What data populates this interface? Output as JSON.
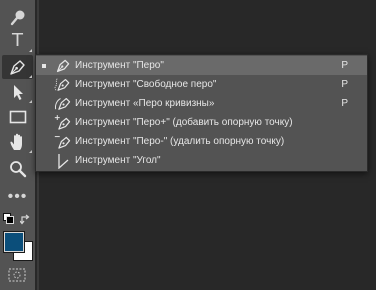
{
  "toolbar": {
    "tools": [
      {
        "id": "quick-selection",
        "icon": "brush-wand-icon"
      },
      {
        "id": "type",
        "icon": "type-icon",
        "glyph": "T"
      },
      {
        "id": "pen",
        "icon": "pen-icon",
        "active": true
      },
      {
        "id": "path-selection",
        "icon": "arrow-select-icon"
      },
      {
        "id": "rectangle",
        "icon": "rectangle-icon"
      },
      {
        "id": "hand",
        "icon": "hand-icon"
      },
      {
        "id": "zoom",
        "icon": "magnifier-icon"
      },
      {
        "id": "more",
        "icon": "ellipsis-icon",
        "glyph": "•••"
      }
    ],
    "foreground_color": "#0b4e7a",
    "background_color": "#ffffff"
  },
  "flyout": {
    "items": [
      {
        "label": "Инструмент \"Перо\"",
        "shortcut": "P",
        "checked": true,
        "icon": "pen-icon"
      },
      {
        "label": "Инструмент \"Свободное перо\"",
        "shortcut": "P",
        "checked": false,
        "icon": "freeform-pen-icon"
      },
      {
        "label": "Инструмент «Перо кривизны»",
        "shortcut": "P",
        "checked": false,
        "icon": "curvature-pen-icon"
      },
      {
        "label": "Инструмент \"Перо+\" (добавить опорную точку)",
        "shortcut": "",
        "checked": false,
        "icon": "add-anchor-point-icon"
      },
      {
        "label": "Инструмент \"Перо-\" (удалить опорную точку)",
        "shortcut": "",
        "checked": false,
        "icon": "delete-anchor-point-icon"
      },
      {
        "label": "Инструмент \"Угол\"",
        "shortcut": "",
        "checked": false,
        "icon": "convert-point-icon"
      }
    ]
  },
  "colors": {
    "panel": "#535353",
    "canvas": "#282828",
    "hover": "#6a6a6a",
    "text": "#e6e6e6"
  }
}
